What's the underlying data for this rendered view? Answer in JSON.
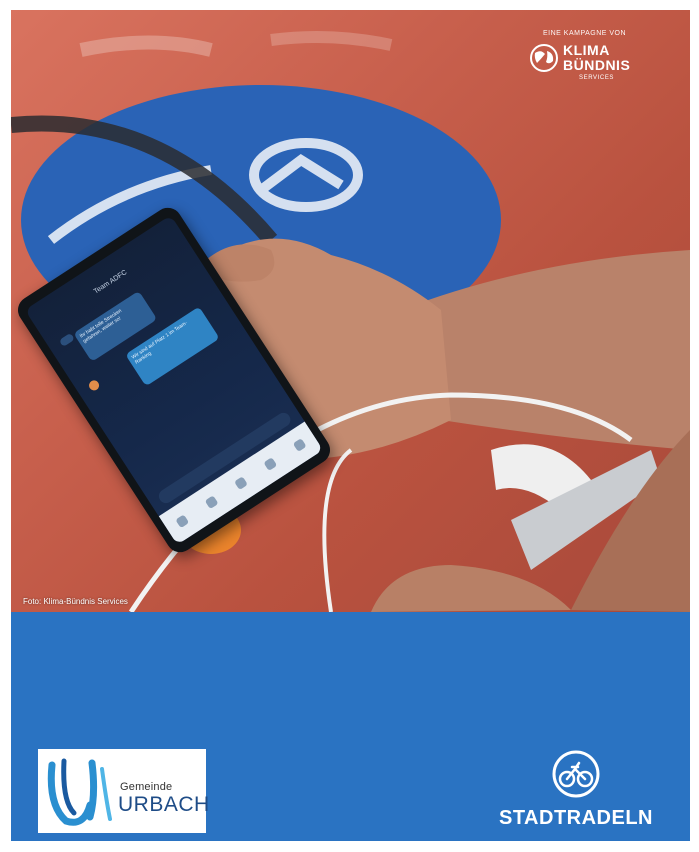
{
  "photo": {
    "credit": "Foto: Klima-Bündnis Services",
    "campaign": {
      "eyebrow": "EINE KAMPAGNE VON",
      "brand_line1": "KLIMA",
      "brand_line2": "BÜNDNIS",
      "brand_sub": "SERVICES"
    },
    "phone_screen": {
      "chat_title": "Team ADFC",
      "tag": "Hey!",
      "bubble1": "Ihr habt tolle Strecken gefahren, weiter so!",
      "bubble2": "Wir sind auf Platz 1 im Team-Ranking",
      "compose_placeholder": "Nachricht"
    }
  },
  "band": {
    "municipality": {
      "line1": "Gemeinde",
      "line2": "URBACH"
    },
    "program": {
      "name": "STADTRADELN",
      "icon": "bicycle-circle-icon"
    }
  },
  "colors": {
    "band_blue": "#2a73c2",
    "track_red": "#c8604d",
    "sign_blue": "#2a63b6"
  }
}
